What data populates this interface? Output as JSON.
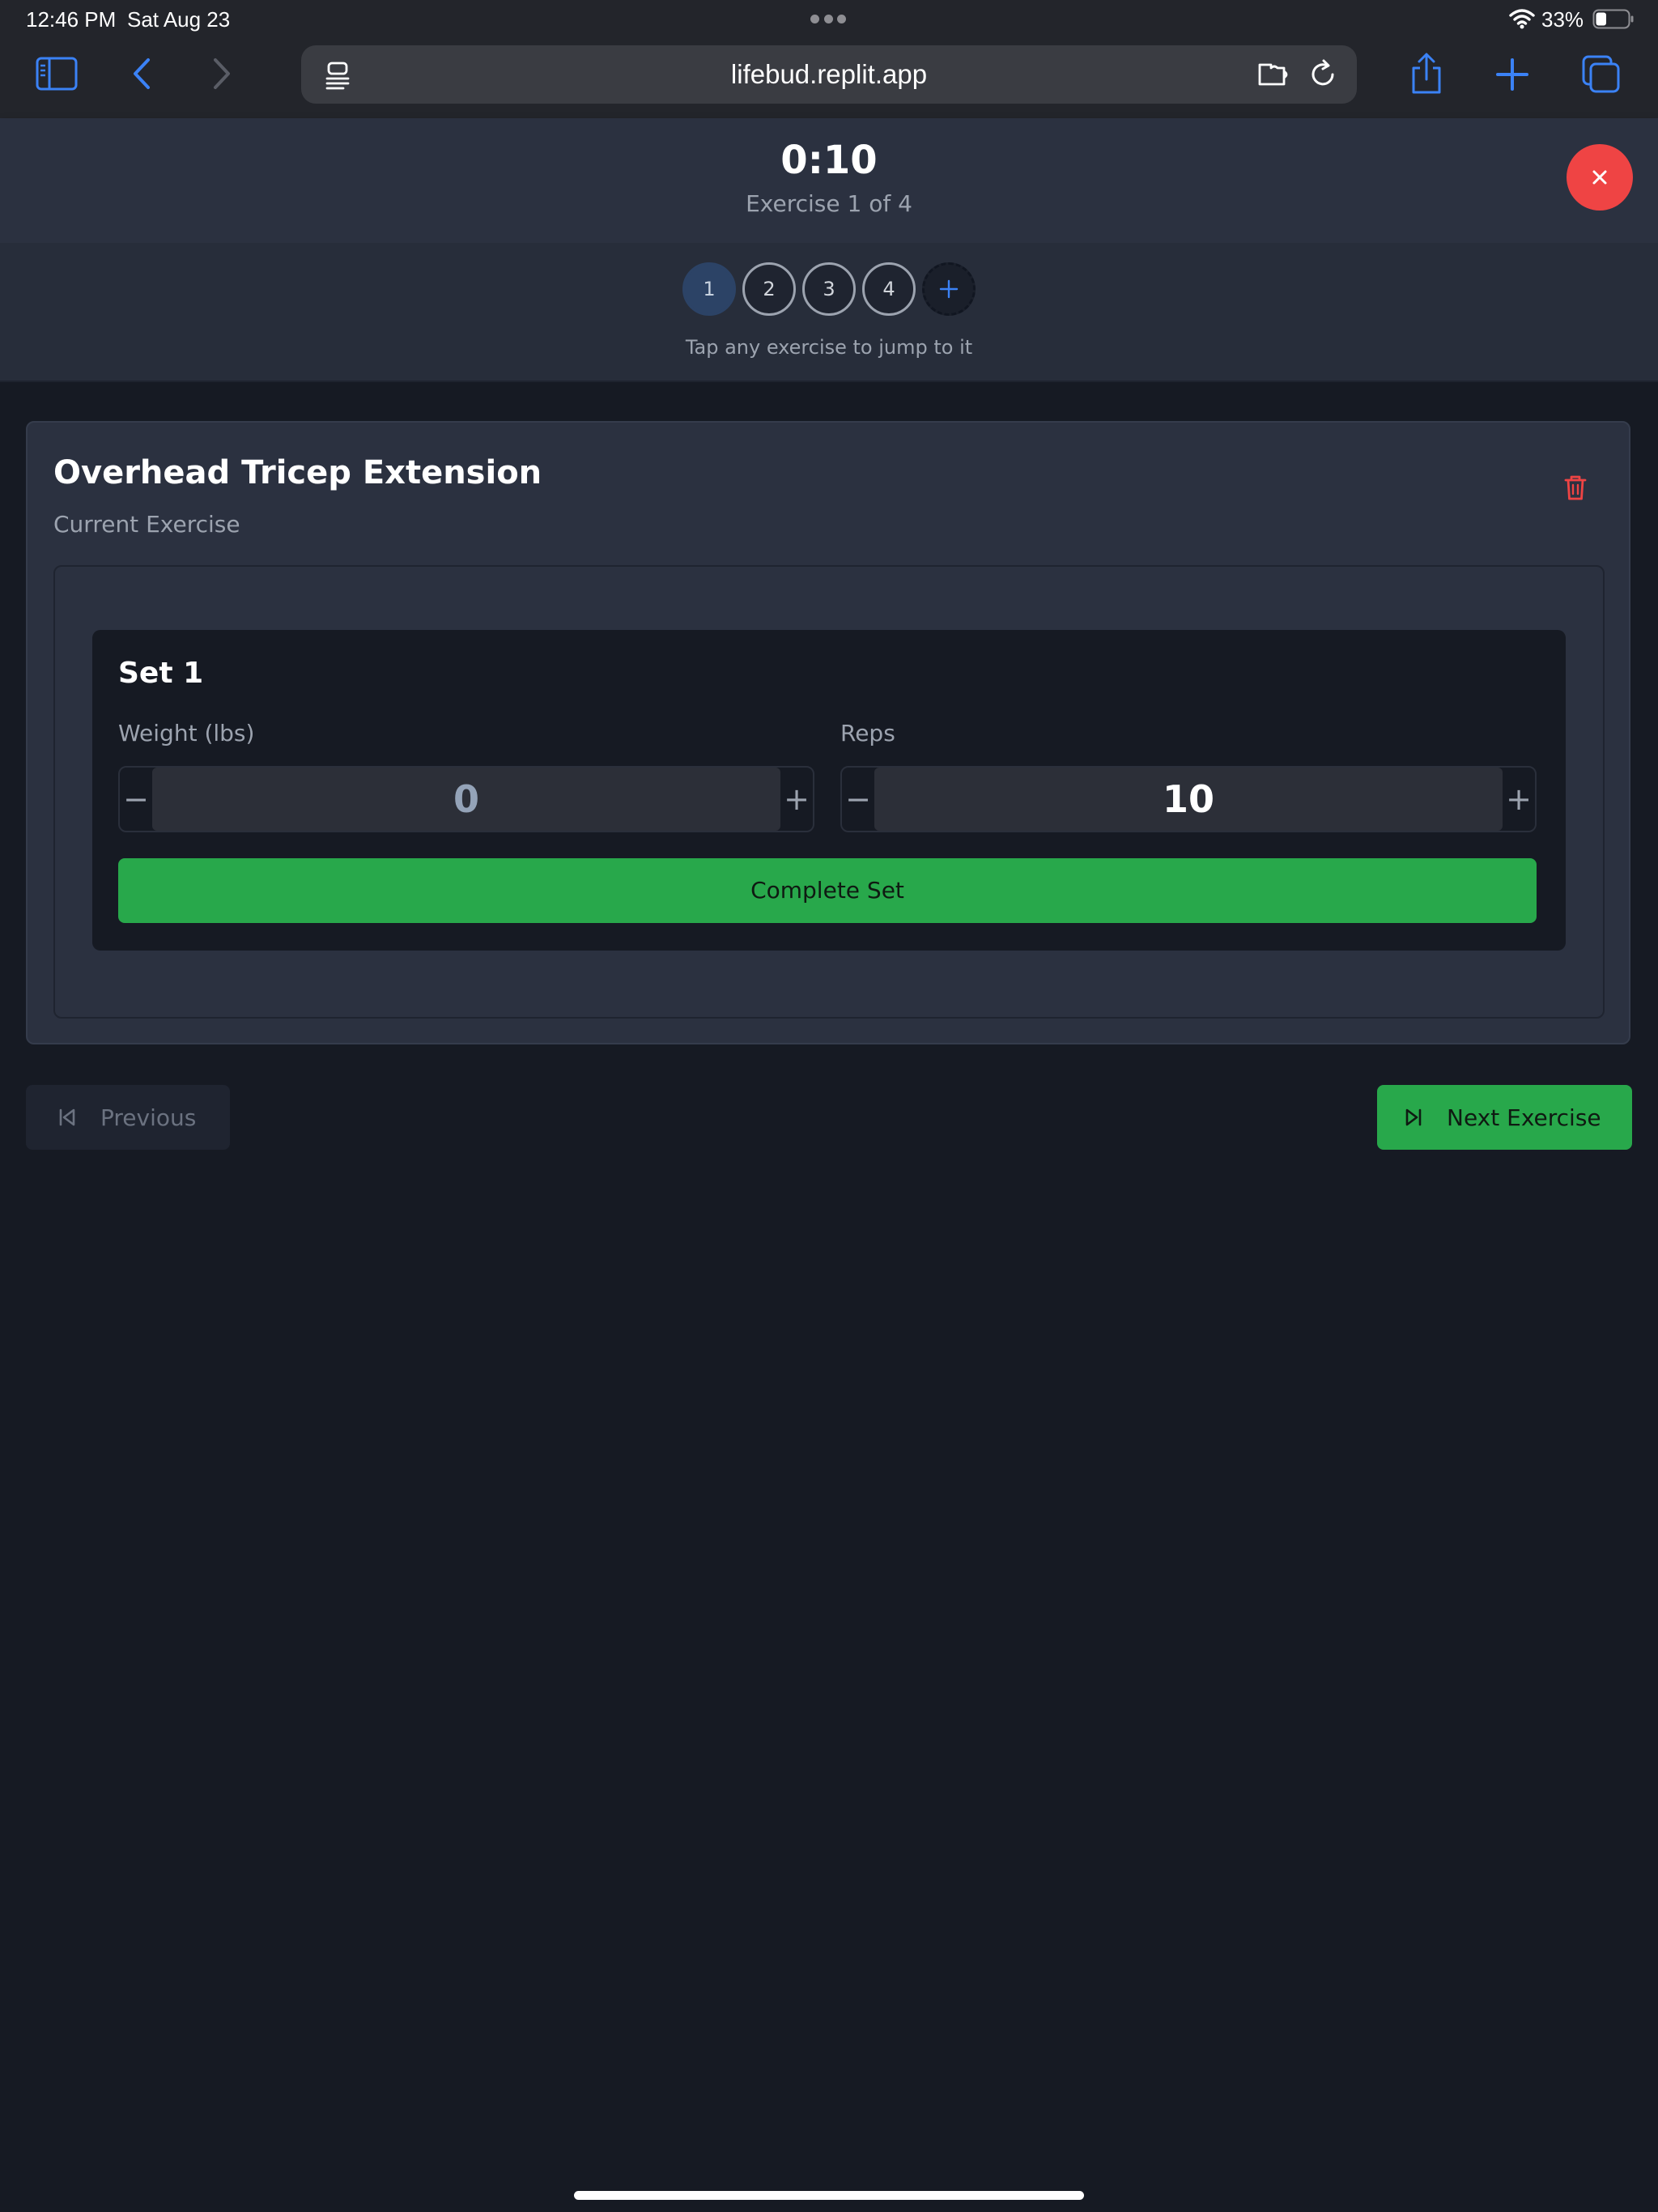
{
  "status_bar": {
    "time": "12:46 PM",
    "date": "Sat Aug 23",
    "battery": "33%",
    "battery_level": 0.33,
    "icons": [
      "wifi-icon",
      "battery-icon"
    ]
  },
  "browser": {
    "url": "lifebud.replit.app",
    "accent_color": "#3b82f6",
    "icons": [
      "sidebar-icon",
      "back-icon",
      "forward-icon",
      "reader-icon",
      "extension-icon",
      "reload-icon",
      "share-icon",
      "new-tab-icon",
      "tabs-icon"
    ]
  },
  "workout": {
    "timer": "0:10",
    "exercise_counter": "Exercise 1 of 4",
    "close_icon": "close-icon",
    "close_color": "#ef4444"
  },
  "navigator": {
    "exercises": [
      "1",
      "2",
      "3",
      "4"
    ],
    "active_index": 0,
    "add_icon": "plus-icon",
    "hint": "Tap any exercise to jump to it"
  },
  "exercise": {
    "name": "Overhead Tricep Extension",
    "subtitle": "Current Exercise",
    "delete_icon": "trash-icon",
    "delete_color": "#ef4444"
  },
  "set": {
    "title": "Set 1",
    "weight_label": "Weight (lbs)",
    "weight_value": "0",
    "reps_label": "Reps",
    "reps_value": "10",
    "decrement_symbol": "−",
    "increment_symbol": "+",
    "complete_label": "Complete Set",
    "complete_color": "#28a84b"
  },
  "bottom_nav": {
    "previous_label": "Previous",
    "previous_icon": "skip-back-icon",
    "next_label": "Next Exercise",
    "next_icon": "skip-forward-icon"
  }
}
